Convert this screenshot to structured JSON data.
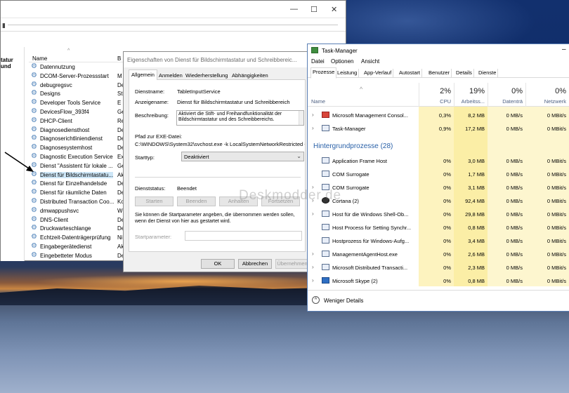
{
  "services_window": {
    "nav_fragment": "tatur und",
    "columns": {
      "name": "Name",
      "second": "B"
    },
    "rows": [
      {
        "name": "Datennutzung",
        "type": ""
      },
      {
        "name": "DCOM-Server-Prozessstart",
        "type": "M"
      },
      {
        "name": "debugregsvc",
        "type": "De"
      },
      {
        "name": "Designs",
        "type": "St"
      },
      {
        "name": "Developer Tools Service",
        "type": "E"
      },
      {
        "name": "DevicesFlow_393f4",
        "type": "Ge"
      },
      {
        "name": "DHCP-Client",
        "type": "Re"
      },
      {
        "name": "Diagnosediensthost",
        "type": "De"
      },
      {
        "name": "Diagnoserichtliniendienst",
        "type": "De"
      },
      {
        "name": "Diagnosesystemhost",
        "type": "De"
      },
      {
        "name": "Diagnostic Execution Service",
        "type": "Ex"
      },
      {
        "name": "Dienst \"Assistent für lokale ...",
        "type": "Ge"
      },
      {
        "name": "Dienst für Bildschirmtastatu...",
        "type": "Ak"
      },
      {
        "name": "Dienst für Einzelhandelsde",
        "type": "De"
      },
      {
        "name": "Dienst für räumliche Daten",
        "type": "De"
      },
      {
        "name": "Distributed Transaction Coo...",
        "type": "Ko"
      },
      {
        "name": "dmwappushsvc",
        "type": "W"
      },
      {
        "name": "DNS-Client",
        "type": "De"
      },
      {
        "name": "Druckwarteschlange",
        "type": "De"
      },
      {
        "name": "Echtzeit-Datenträgerprüfung",
        "type": "Ni"
      },
      {
        "name": "Eingabegerätedienst",
        "type": "Ak"
      },
      {
        "name": "Eingebetteter Modus",
        "type": "De"
      }
    ]
  },
  "dialog": {
    "title": "Eigenschaften von Dienst für Bildschirmtastatur und Schreibbereic...",
    "tabs": [
      "Allgemein",
      "Anmelden",
      "Wiederherstellung",
      "Abhängigkeiten"
    ],
    "service_name_label": "Dienstname:",
    "service_name": "TabletInputService",
    "display_name_label": "Anzeigename:",
    "display_name": "Dienst für Bildschirmtastatur und Schreibbereich",
    "description_label": "Beschreibung:",
    "description_line1": "Aktiviert die Stift- und Freihandfunktionalität der",
    "description_line2": "Bildschirmtastatur und des Schreibbereichs.",
    "path_label": "Pfad zur EXE-Datei:",
    "path": "C:\\WINDOWS\\System32\\svchost.exe -k LocalSystemNetworkRestricted -p",
    "starttype_label": "Starttyp:",
    "starttype_value": "Deaktiviert",
    "status_label": "Dienststatus:",
    "status_value": "Beendet",
    "btn_start": "Starten",
    "btn_stop": "Beenden",
    "btn_pause": "Anhalten",
    "btn_resume": "Fortsetzen",
    "hint_line1": "Sie können die Startparameter angeben, die übernommen werden sollen,",
    "hint_line2": "wenn der Dienst von hier aus gestartet wird.",
    "params_label": "Startparameter:",
    "ok": "OK",
    "cancel": "Abbrechen",
    "apply": "Übernehmen"
  },
  "taskmanager": {
    "title": "Task-Manager",
    "menu": [
      "Datei",
      "Optionen",
      "Ansicht"
    ],
    "tabs": [
      "Prozesse",
      "Leistung",
      "App-Verlauf",
      "Autostart",
      "Benutzer",
      "Details",
      "Dienste"
    ],
    "name_header": "Name",
    "cols": [
      {
        "pct": "2%",
        "cap": "CPU"
      },
      {
        "pct": "19%",
        "cap": "Arbeitss..."
      },
      {
        "pct": "0%",
        "cap": "Datenträ"
      },
      {
        "pct": "0%",
        "cap": "Netzwerk"
      }
    ],
    "apps": [
      {
        "name": "Microsoft Management Consol...",
        "cpu": "0,3%",
        "mem": "8,2 MB",
        "disk": "0 MB/s",
        "net": "0 MBit/s",
        "icon": "red",
        "expand": true
      },
      {
        "name": "Task-Manager",
        "cpu": "0,9%",
        "mem": "17,2 MB",
        "disk": "0 MB/s",
        "net": "0 MBit/s",
        "icon": "",
        "expand": true
      }
    ],
    "group_title": "Hintergrundprozesse (28)",
    "background": [
      {
        "name": "Application Frame Host",
        "cpu": "0%",
        "mem": "3,0 MB",
        "disk": "0 MB/s",
        "net": "0 MBit/s",
        "icon": "",
        "expand": false
      },
      {
        "name": "COM Surrogate",
        "cpu": "0%",
        "mem": "1,7 MB",
        "disk": "0 MB/s",
        "net": "0 MBit/s",
        "icon": "",
        "expand": false
      },
      {
        "name": "COM Surrogate",
        "cpu": "0%",
        "mem": "3,1 MB",
        "disk": "0 MB/s",
        "net": "0 MBit/s",
        "icon": "",
        "expand": true
      },
      {
        "name": "Cortana (2)",
        "cpu": "0%",
        "mem": "92,4 MB",
        "disk": "0 MB/s",
        "net": "0 MBit/s",
        "icon": "dark",
        "expand": true
      },
      {
        "name": "Host für die Windows Shell-Ob...",
        "cpu": "0%",
        "mem": "29,8 MB",
        "disk": "0 MB/s",
        "net": "0 MBit/s",
        "icon": "",
        "expand": true
      },
      {
        "name": "Host Process for Setting Synchr...",
        "cpu": "0%",
        "mem": "0,8 MB",
        "disk": "0 MB/s",
        "net": "0 MBit/s",
        "icon": "",
        "expand": false
      },
      {
        "name": "Hostprozess für Windows-Aufg...",
        "cpu": "0%",
        "mem": "3,4 MB",
        "disk": "0 MB/s",
        "net": "0 MBit/s",
        "icon": "",
        "expand": false
      },
      {
        "name": "ManagementAgentHost.exe",
        "cpu": "0%",
        "mem": "2,6 MB",
        "disk": "0 MB/s",
        "net": "0 MBit/s",
        "icon": "",
        "expand": true
      },
      {
        "name": "Microsoft Distributed Transacti...",
        "cpu": "0%",
        "mem": "2,3 MB",
        "disk": "0 MB/s",
        "net": "0 MBit/s",
        "icon": "",
        "expand": true
      },
      {
        "name": "Microsoft Skype (2)",
        "cpu": "0%",
        "mem": "0,8 MB",
        "disk": "0 MB/s",
        "net": "0 MBit/s",
        "icon": "blue",
        "expand": true
      }
    ],
    "fewer_details": "Weniger Details"
  },
  "watermark": "Deskmodder.de"
}
